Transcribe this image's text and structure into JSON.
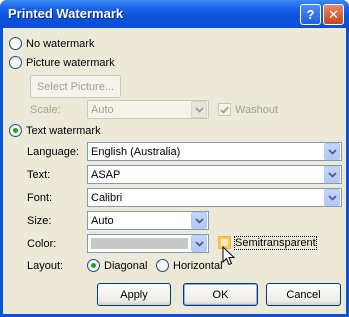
{
  "window": {
    "title": "Printed Watermark"
  },
  "titlebar_buttons": {
    "help": "?",
    "close": "✕"
  },
  "options": {
    "no_watermark": "No watermark",
    "picture_watermark": "Picture watermark",
    "text_watermark": "Text watermark"
  },
  "picture": {
    "select_picture_label": "Select Picture...",
    "scale_label": "Scale:",
    "scale_value": "Auto",
    "washout_label": "Washout",
    "washout_checked": true
  },
  "text": {
    "language_label": "Language:",
    "language_value": "English (Australia)",
    "text_label": "Text:",
    "text_value": "ASAP",
    "font_label": "Font:",
    "font_value": "Calibri",
    "size_label": "Size:",
    "size_value": "Auto",
    "color_label": "Color:",
    "color_value": "#c8c8c8",
    "semitransparent_label": "Semitransparent",
    "semitransparent_checked": false,
    "layout_label": "Layout:",
    "layout_diagonal": "Diagonal",
    "layout_horizontal": "Horizontal",
    "layout_selected": "Diagonal"
  },
  "selected_option": "text_watermark",
  "buttons": {
    "apply": "Apply",
    "ok": "OK",
    "cancel": "Cancel"
  },
  "colors": {
    "titlebar": "#0b53d7",
    "dialog_bg": "#ece9d8",
    "accent_green": "#22a027"
  }
}
